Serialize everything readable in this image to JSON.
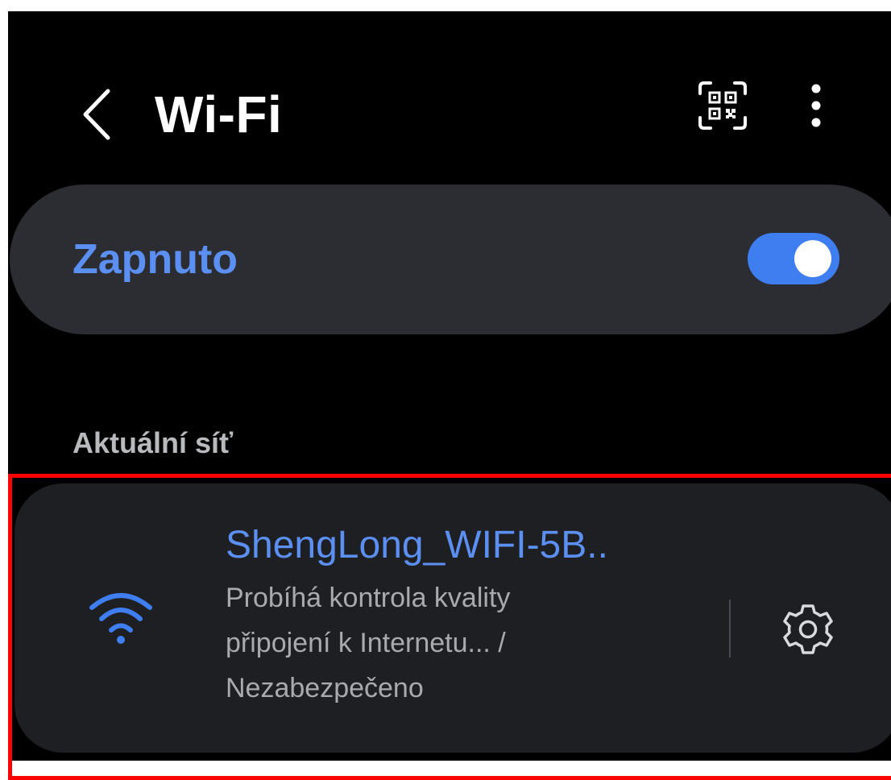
{
  "header": {
    "title": "Wi-Fi",
    "icons": {
      "back": "chevron-left-icon",
      "qr": "qr-code-scan-icon",
      "more": "more-vertical-icon"
    }
  },
  "master_toggle": {
    "label": "Zapnuto",
    "state": "on",
    "label_color": "#5b8ff2",
    "track_color": "#3f7ef0"
  },
  "current_network_section": {
    "heading": "Aktuální síť"
  },
  "current_network": {
    "ssid": "ShengLong_WIFI-5B..",
    "status_line_1": "Probíhá kontrola kvality",
    "status_line_2": "připojení k Internetu... /",
    "status_line_3": "Nezabezpečeno",
    "signal_icon": "wifi-signal-icon",
    "settings_icon": "gear-icon",
    "accent_color": "#5b8ff2"
  },
  "highlight": {
    "color": "#ff0000"
  }
}
